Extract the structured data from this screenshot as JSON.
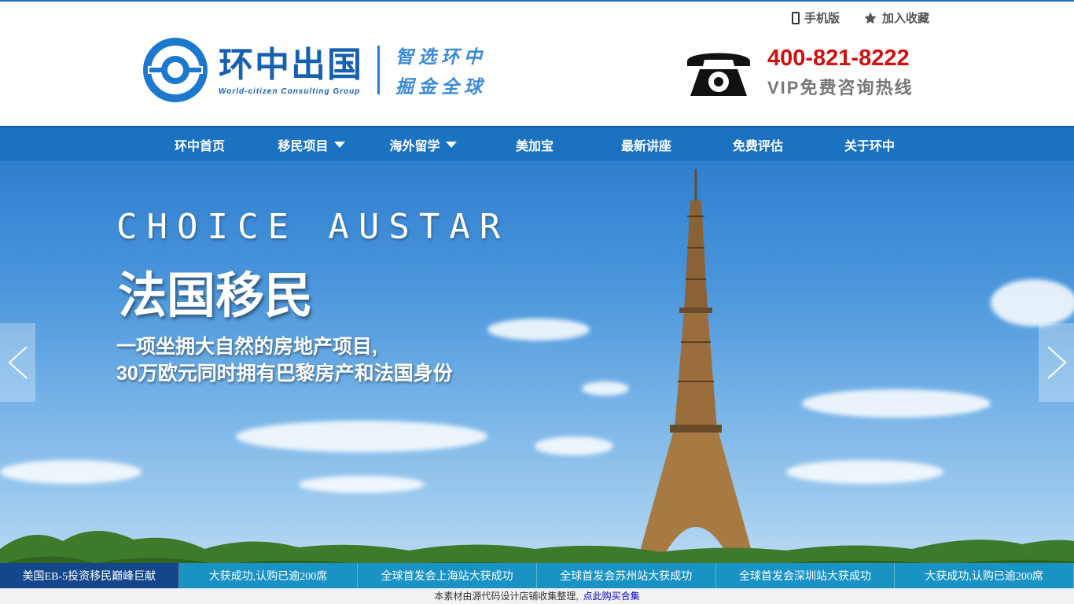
{
  "header": {
    "mobile_label": "手机版",
    "favorite_label": "加入收藏",
    "logo_cn": "环中出国",
    "logo_en": "World-citizen Consulting Group",
    "slogan_line1": "智选环中",
    "slogan_line2": "掘金全球",
    "hotline_number": "400-821-8222",
    "hotline_label": "VIP免费咨询热线"
  },
  "nav": {
    "items": [
      {
        "label": "环中首页",
        "dropdown": false
      },
      {
        "label": "移民项目",
        "dropdown": true
      },
      {
        "label": "海外留学",
        "dropdown": true
      },
      {
        "label": "美加宝",
        "dropdown": false
      },
      {
        "label": "最新讲座",
        "dropdown": false
      },
      {
        "label": "免费评估",
        "dropdown": false
      },
      {
        "label": "关于环中",
        "dropdown": false
      }
    ]
  },
  "banner": {
    "en_title": "CHOICE AUSTAR",
    "title": "法国移民",
    "line1": "一项坐拥大自然的房地产项目,",
    "line2": "30万欧元同时拥有巴黎房产和法国身份"
  },
  "ticker": [
    "美国EB-5投资移民巅峰巨献",
    "大获成功,认购已逾200席",
    "全球首发会上海站大获成功",
    "全球首发会苏州站大获成功",
    "全球首发会深圳站大获成功",
    "大获成功,认购已逾200席"
  ],
  "footer_note": {
    "text": "本素材由源代码设计店铺收集整理,",
    "link": "点此购买合集"
  },
  "colors": {
    "brand_blue": "#1660b0",
    "nav_blue": "#1a72c0",
    "hotline_red": "#d01010",
    "ticker_blue": "#1992c4",
    "ticker_dark": "#14478a"
  }
}
